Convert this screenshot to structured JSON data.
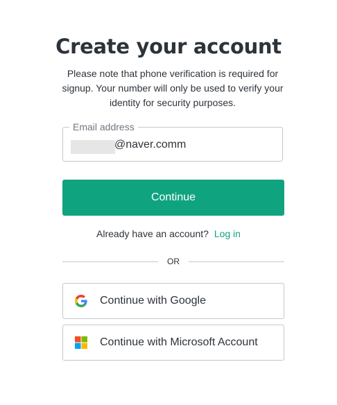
{
  "heading": "Create your account",
  "subtitle": "Please note that phone verification is required for signup. Your number will only be used to verify your identity for security purposes.",
  "email_field": {
    "label": "Email address",
    "value": "@naver.comm"
  },
  "continue_label": "Continue",
  "login_prompt": "Already have an account?",
  "login_link": "Log in",
  "divider_text": "OR",
  "social_buttons": [
    {
      "label": "Continue with Google",
      "icon": "google-icon"
    },
    {
      "label": "Continue with Microsoft Account",
      "icon": "microsoft-icon"
    }
  ],
  "colors": {
    "accent": "#10a37f",
    "text": "#2d333a",
    "border": "#c2c8d0",
    "muted": "#6f7780"
  }
}
